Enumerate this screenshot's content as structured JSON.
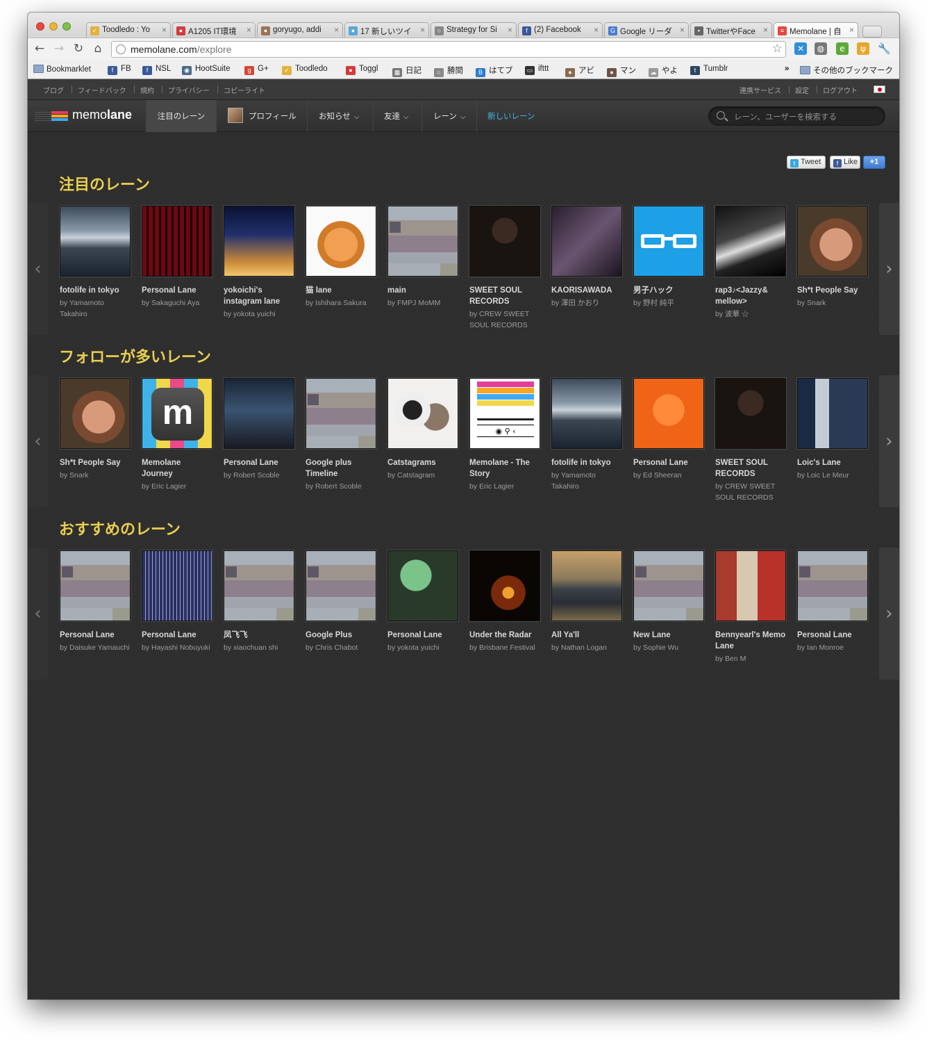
{
  "browser": {
    "tabs": [
      {
        "label": "Toodledo : Yo",
        "favicon_color": "#e1b23c",
        "favicon_glyph": "✓"
      },
      {
        "label": "A1205 IT環境",
        "favicon_color": "#d33b3b",
        "favicon_glyph": "●"
      },
      {
        "label": "goryugo, addi",
        "favicon_color": "#9a7456",
        "favicon_glyph": "●"
      },
      {
        "label": "17 新しいツイ",
        "favicon_color": "#5aa7d8",
        "favicon_glyph": "●"
      },
      {
        "label": "Strategy for Si",
        "favicon_color": "#888888",
        "favicon_glyph": "○"
      },
      {
        "label": "(2) Facebook",
        "favicon_color": "#3b5998",
        "favicon_glyph": "f"
      },
      {
        "label": "Google リーダ",
        "favicon_color": "#4a7bd1",
        "favicon_glyph": "G"
      },
      {
        "label": "TwitterやFace",
        "favicon_color": "#666666",
        "favicon_glyph": "▪"
      },
      {
        "label": "Memolane | 自",
        "favicon_color": "#e9453f",
        "favicon_glyph": "≡"
      }
    ],
    "active_tab_index": 8,
    "url": {
      "host": "memolane.com",
      "path": "/explore"
    },
    "bookmarks": [
      {
        "label": "Bookmarklet",
        "icon": "folder-icon",
        "color": "#8fa7c9"
      },
      {
        "label": "FB",
        "icon": "facebook-icon",
        "color": "#3b5998",
        "glyph": "f"
      },
      {
        "label": "NSL",
        "icon": "facebook-icon",
        "color": "#3b5998",
        "glyph": "f"
      },
      {
        "label": "HootSuite",
        "icon": "owl-icon",
        "color": "#4a6b8a",
        "glyph": "◉"
      },
      {
        "label": "G+",
        "icon": "google-plus-icon",
        "color": "#d34836",
        "glyph": "g"
      },
      {
        "label": "Toodledo",
        "icon": "check-icon",
        "color": "#e1b23c",
        "glyph": "✓"
      },
      {
        "label": "Toggl",
        "icon": "toggl-icon",
        "color": "#d33b3b",
        "glyph": "●"
      },
      {
        "label": "日記",
        "icon": "grid-icon",
        "color": "#777777",
        "glyph": "▦"
      },
      {
        "label": "勝間",
        "icon": "globe-icon",
        "color": "#888888",
        "glyph": "○"
      },
      {
        "label": "はてブ",
        "icon": "hatena-icon",
        "color": "#2b7cd3",
        "glyph": "B"
      },
      {
        "label": "ifttt",
        "icon": "ifttt-icon",
        "color": "#333333",
        "glyph": "▭"
      },
      {
        "label": "アビ",
        "icon": "avatar-icon",
        "color": "#8b6a4f",
        "glyph": "●"
      },
      {
        "label": "マン",
        "icon": "avatar-icon",
        "color": "#6e5543",
        "glyph": "●"
      },
      {
        "label": "やよ",
        "icon": "cloud-icon",
        "color": "#9a9a9a",
        "glyph": "☁"
      },
      {
        "label": "Tumblr",
        "icon": "tumblr-icon",
        "color": "#2c4762",
        "glyph": "t"
      }
    ],
    "bookmarks_overflow": "»",
    "other_bookmarks": "その他のブックマーク"
  },
  "site": {
    "top_links_left": [
      "ブログ",
      "フィードバック",
      "規約",
      "プライバシー",
      "コピーライト"
    ],
    "top_links_right": [
      "連携サービス",
      "設定",
      "ログアウト"
    ],
    "logo": {
      "light": "memo",
      "bold": "lane",
      "bar_colors": [
        "#e23d5a",
        "#f6a623",
        "#3fa9f5"
      ]
    },
    "nav": {
      "featured": "注目のレーン",
      "profile": "プロフィール",
      "news": "お知らせ",
      "friends": "友達",
      "lanes": "レーン",
      "new_lane": "新しいレーン"
    },
    "search_placeholder": "レーン、ユーザーを検索する",
    "social": {
      "tweet": "Tweet",
      "like": "Like",
      "plusone": "+1"
    }
  },
  "sections": [
    {
      "title": "注目のレーン",
      "cards": [
        {
          "title": "fotolife in tokyo",
          "by": "by Yamamoto Takahiro",
          "thumb": "bridge"
        },
        {
          "title": "Personal Lane",
          "by": "by Sakaguchi Aya",
          "thumb": "bar"
        },
        {
          "title": "yokoichi's instagram lane",
          "by": "by yokota yuichi",
          "thumb": "dusk"
        },
        {
          "title": "猫 lane",
          "by": "by Ishihara Sakura",
          "thumb": "cat"
        },
        {
          "title": "main",
          "by": "by FMPJ MoMM",
          "thumb": "placeholder"
        },
        {
          "title": "SWEET SOUL RECORDS",
          "by": "by CREW SWEET SOUL RECORDS",
          "thumb": "album"
        },
        {
          "title": "KAORISAWADA",
          "by": "by 澤田 かおり",
          "thumb": "room"
        },
        {
          "title": "男子ハック",
          "by": "by 野村 純平",
          "thumb": "glasses"
        },
        {
          "title": "rap3♪<Jazzy& mellow>",
          "by": "by 波華 ☆",
          "thumb": "bw"
        },
        {
          "title": "Sh*t People Say",
          "by": "by Snark",
          "thumb": "face"
        }
      ]
    },
    {
      "title": "フォローが多いレーン",
      "cards": [
        {
          "title": "Sh*t People Say",
          "by": "by Snark",
          "thumb": "face"
        },
        {
          "title": "Memolane Journey",
          "by": "by Eric Lagier",
          "thumb": "mlogo"
        },
        {
          "title": "Personal Lane",
          "by": "by Robert Scoble",
          "thumb": "stage"
        },
        {
          "title": "Google plus Timeline",
          "by": "by Robert Scoble",
          "thumb": "placeholder"
        },
        {
          "title": "Catstagrams",
          "by": "by Catstagram",
          "thumb": "cats"
        },
        {
          "title": "Memolane - The Story",
          "by": "by Eric Lagier",
          "thumb": "mwordmark"
        },
        {
          "title": "fotolife in tokyo",
          "by": "by Yamamoto Takahiro",
          "thumb": "bridge"
        },
        {
          "title": "Personal Lane",
          "by": "by Ed Sheeran",
          "thumb": "orange"
        },
        {
          "title": "SWEET SOUL RECORDS",
          "by": "by CREW SWEET SOUL RECORDS",
          "thumb": "album"
        },
        {
          "title": "Loic's Lane",
          "by": "by Loic Le Meur",
          "thumb": "man"
        }
      ]
    },
    {
      "title": "おすすめのレーン",
      "cards": [
        {
          "title": "Personal Lane",
          "by": "by Daisuke Yamauchi",
          "thumb": "placeholder"
        },
        {
          "title": "Personal Lane",
          "by": "by Hayashi Nobuyuki",
          "thumb": "corridor"
        },
        {
          "title": "凤飞飞",
          "by": "by xiaochuan shi",
          "thumb": "placeholder"
        },
        {
          "title": "Google Plus",
          "by": "by Chris Chabot",
          "thumb": "placeholder"
        },
        {
          "title": "Personal Lane",
          "by": "by yokota yuichi",
          "thumb": "screen"
        },
        {
          "title": "Under the Radar",
          "by": "by Brisbane Festival",
          "thumb": "theatre"
        },
        {
          "title": "All Ya'll",
          "by": "by Nathan Logan",
          "thumb": "car"
        },
        {
          "title": "New Lane",
          "by": "by Sophie Wu",
          "thumb": "placeholder"
        },
        {
          "title": "Bennyearl's Memo Lane",
          "by": "by Ben M",
          "thumb": "family"
        },
        {
          "title": "Personal Lane",
          "by": "by Ian Monroe",
          "thumb": "placeholder"
        }
      ]
    }
  ],
  "colors": {
    "section_title": "#e9cf4f",
    "accent_blue": "#43b7e8",
    "page_bg": "#2d2d2d"
  }
}
